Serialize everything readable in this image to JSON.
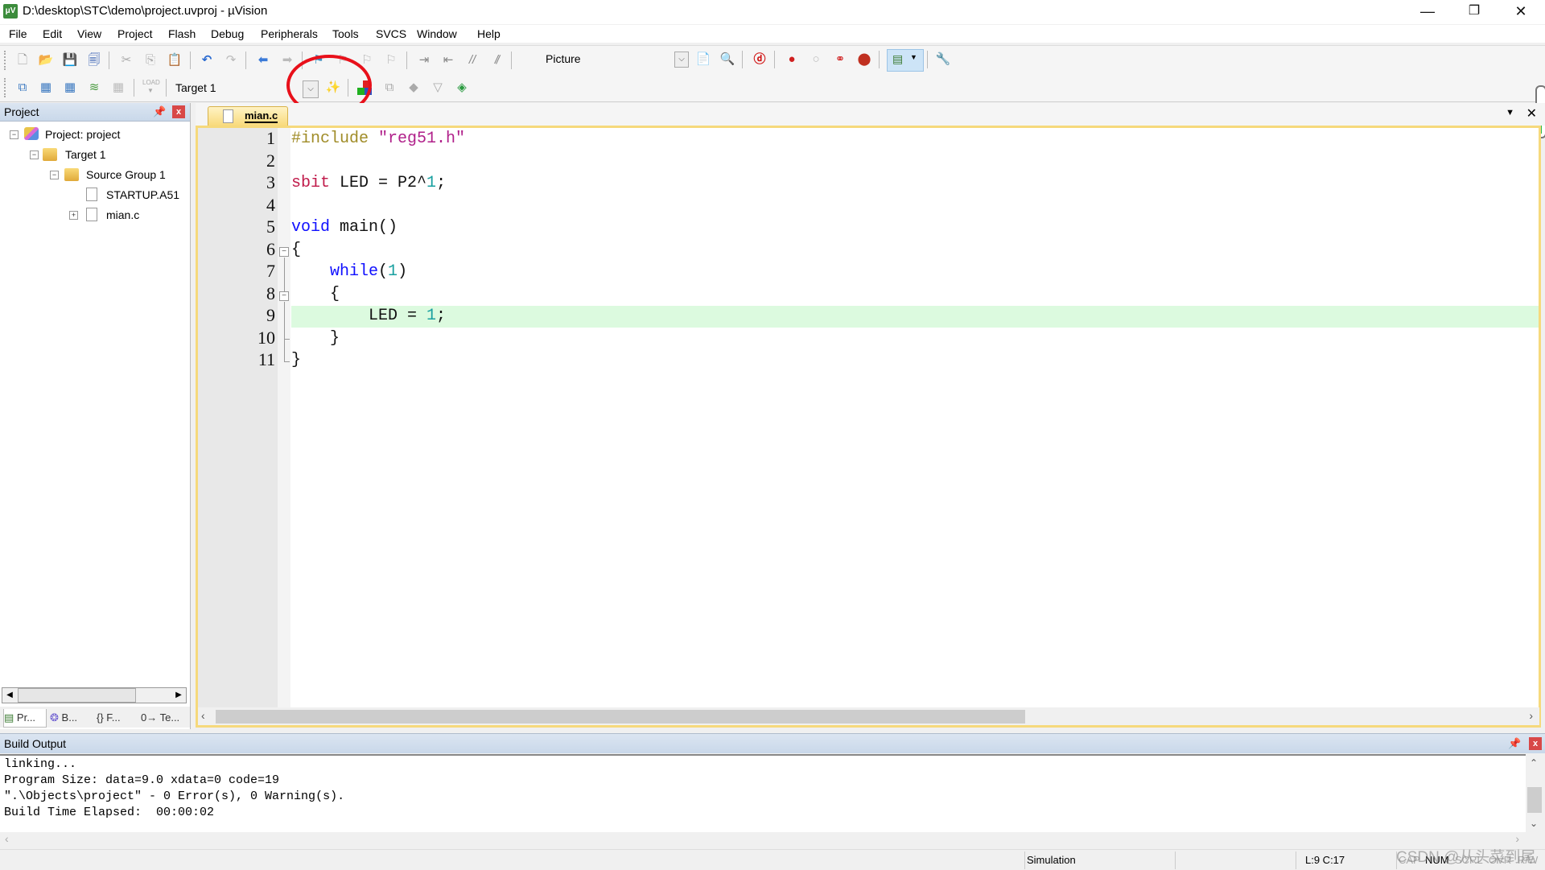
{
  "window": {
    "title": "D:\\desktop\\STC\\demo\\project.uvproj - µVision",
    "app_icon": "uvision-logo-icon",
    "controls": {
      "minimize": "—",
      "restore": "❐",
      "close": "✕"
    }
  },
  "menu": [
    "File",
    "Edit",
    "View",
    "Project",
    "Flash",
    "Debug",
    "Peripherals",
    "Tools",
    "SVCS",
    "Window",
    "Help"
  ],
  "toolbar1": {
    "icons": [
      "new-file-icon",
      "open-file-icon",
      "save-icon",
      "save-all-icon",
      "cut-icon",
      "copy-icon",
      "paste-icon",
      "undo-icon",
      "redo-icon",
      "navigate-back-icon",
      "navigate-forward-icon",
      "bookmark-set-icon",
      "bookmark-prev-icon",
      "bookmark-next-icon",
      "bookmark-clear-icon",
      "indent-icon",
      "unindent-icon",
      "comment-icon",
      "uncomment-icon",
      "find-in-files-icon"
    ],
    "find_combo_value": "Picture",
    "icons_right": [
      "incremental-find-icon",
      "find-icon",
      "debug-session-icon",
      "breakpoint-insert-icon",
      "breakpoint-enable-icon",
      "breakpoint-disable-all-icon",
      "breakpoint-kill-all-icon",
      "window-layout-icon",
      "configure-icon"
    ]
  },
  "toolbar2": {
    "icons": [
      "translate-icon",
      "build-icon",
      "rebuild-icon",
      "batch-build-icon",
      "stop-build-icon",
      "download-icon"
    ],
    "target_value": "Target 1",
    "icons_right": [
      "target-options-icon",
      "manage-components-icon",
      "select-packs-icon",
      "pack-installer-icon",
      "event-recorder-icon",
      "manage-run-time-icon"
    ],
    "annotation": "red-circle-highlight"
  },
  "project_panel": {
    "title": "Project",
    "tree": [
      {
        "label": "Project: project",
        "level": 0,
        "toggle": "−",
        "icon": "project-icon"
      },
      {
        "label": "Target 1",
        "level": 1,
        "toggle": "−",
        "icon": "target-folder-icon"
      },
      {
        "label": "Source Group 1",
        "level": 2,
        "toggle": "−",
        "icon": "folder-icon"
      },
      {
        "label": "STARTUP.A51",
        "level": 3,
        "toggle": "",
        "icon": "file-icon"
      },
      {
        "label": "mian.c",
        "level": 3,
        "toggle": "+",
        "icon": "file-icon"
      }
    ],
    "tabs": [
      "Pr...",
      "B...",
      "{} F...",
      "0→ Te..."
    ]
  },
  "editor": {
    "tab_label": "mian.c",
    "current_line": 9,
    "lines": [
      {
        "n": "1",
        "tokens": [
          {
            "t": "#include ",
            "c": "pp"
          },
          {
            "t": "\"reg51.h\"",
            "c": "str"
          }
        ]
      },
      {
        "n": "2",
        "tokens": []
      },
      {
        "n": "3",
        "tokens": [
          {
            "t": "sbit",
            "c": "sbit"
          },
          {
            "t": " LED = P2^",
            "c": ""
          },
          {
            "t": "1",
            "c": "num"
          },
          {
            "t": ";",
            "c": ""
          }
        ]
      },
      {
        "n": "4",
        "tokens": []
      },
      {
        "n": "5",
        "tokens": [
          {
            "t": "void",
            "c": "kw"
          },
          {
            "t": " main()",
            "c": ""
          }
        ]
      },
      {
        "n": "6",
        "tokens": [
          {
            "t": "{",
            "c": ""
          }
        ]
      },
      {
        "n": "7",
        "tokens": [
          {
            "t": "    ",
            "c": ""
          },
          {
            "t": "while",
            "c": "kw"
          },
          {
            "t": "(",
            "c": ""
          },
          {
            "t": "1",
            "c": "num"
          },
          {
            "t": ")",
            "c": ""
          }
        ]
      },
      {
        "n": "8",
        "tokens": [
          {
            "t": "    {",
            "c": ""
          }
        ]
      },
      {
        "n": "9",
        "tokens": [
          {
            "t": "        LED = ",
            "c": ""
          },
          {
            "t": "1",
            "c": "num"
          },
          {
            "t": ";",
            "c": ""
          }
        ]
      },
      {
        "n": "10",
        "tokens": [
          {
            "t": "    }",
            "c": ""
          }
        ]
      },
      {
        "n": "11",
        "tokens": [
          {
            "t": "}",
            "c": ""
          }
        ]
      }
    ]
  },
  "build_output": {
    "title": "Build Output",
    "lines": [
      "linking...",
      "Program Size: data=9.0 xdata=0 code=19",
      "\".\\Objects\\project\" - 0 Error(s), 0 Warning(s).",
      "Build Time Elapsed:  00:00:02"
    ]
  },
  "statusbar": {
    "mode": "Simulation",
    "position": "L:9 C:17",
    "indicators": [
      "CAP",
      "NUM",
      "SCRL",
      "OVR",
      "R/W"
    ],
    "active_indicators": [
      "NUM"
    ]
  },
  "watermark": "CSDN @从头菜到尾"
}
